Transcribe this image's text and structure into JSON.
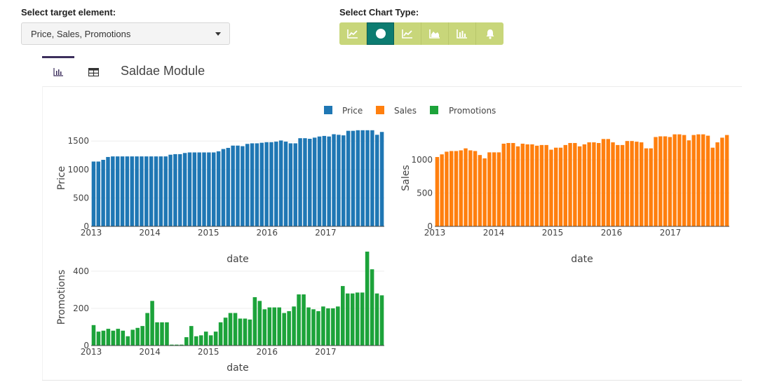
{
  "controls": {
    "target_label": "Select target element:",
    "target_value": "Price, Sales, Promotions",
    "charttype_label": "Select Chart Type:",
    "chart_types": [
      {
        "icon": "line-chart-icon",
        "active": false
      },
      {
        "icon": "circle-icon",
        "active": true
      },
      {
        "icon": "line-chart-icon",
        "active": false
      },
      {
        "icon": "area-chart-icon",
        "active": false
      },
      {
        "icon": "bar-chart-icon",
        "active": false
      },
      {
        "icon": "bell-icon",
        "active": false
      }
    ]
  },
  "tabs": {
    "chart_icon": "bar-chart-icon",
    "table_icon": "table-icon",
    "module_title": "Saldae Module"
  },
  "legend": [
    {
      "name": "Price",
      "color": "#1f77b4"
    },
    {
      "name": "Sales",
      "color": "#ff7f0e"
    },
    {
      "name": "Promotions",
      "color": "#1ca33a"
    }
  ],
  "chart_data": [
    {
      "type": "bar",
      "series_name": "Price",
      "color": "#1f77b4",
      "xlabel": "date",
      "ylabel": "Price",
      "x_ticks": [
        "2013",
        "2014",
        "2015",
        "2016",
        "2017"
      ],
      "y_ticks": [
        0,
        500,
        1000,
        1500
      ],
      "ylim": [
        0,
        1700
      ],
      "x_start": "2013-01",
      "values": [
        1140,
        1140,
        1170,
        1220,
        1230,
        1230,
        1230,
        1230,
        1230,
        1230,
        1230,
        1230,
        1230,
        1230,
        1230,
        1230,
        1260,
        1270,
        1270,
        1290,
        1300,
        1300,
        1300,
        1300,
        1300,
        1300,
        1320,
        1360,
        1380,
        1420,
        1420,
        1410,
        1450,
        1460,
        1460,
        1470,
        1480,
        1480,
        1490,
        1510,
        1490,
        1460,
        1460,
        1550,
        1550,
        1540,
        1560,
        1580,
        1590,
        1580,
        1620,
        1610,
        1600,
        1680,
        1680,
        1690,
        1690,
        1690,
        1690,
        1610,
        1660
      ]
    },
    {
      "type": "bar",
      "series_name": "Sales",
      "color": "#ff7f0e",
      "xlabel": "date",
      "ylabel": "Sales",
      "x_ticks": [
        "2013",
        "2014",
        "2015",
        "2016",
        "2017"
      ],
      "y_ticks": [
        0,
        500,
        1000
      ],
      "ylim": [
        0,
        1450
      ],
      "x_start": "2013-01",
      "values": [
        1040,
        1080,
        1120,
        1130,
        1130,
        1140,
        1170,
        1140,
        1130,
        1070,
        1020,
        1110,
        1110,
        1110,
        1240,
        1250,
        1250,
        1200,
        1240,
        1230,
        1230,
        1210,
        1220,
        1220,
        1150,
        1180,
        1180,
        1220,
        1250,
        1250,
        1200,
        1230,
        1260,
        1260,
        1250,
        1310,
        1310,
        1260,
        1220,
        1220,
        1280,
        1280,
        1270,
        1260,
        1170,
        1170,
        1340,
        1350,
        1350,
        1340,
        1380,
        1380,
        1370,
        1290,
        1370,
        1380,
        1380,
        1360,
        1180,
        1260,
        1330,
        1370
      ]
    },
    {
      "type": "bar",
      "series_name": "Promotions",
      "color": "#1ca33a",
      "xlabel": "date",
      "ylabel": "Promotions",
      "x_ticks": [
        "2013",
        "2014",
        "2015",
        "2016",
        "2017"
      ],
      "y_ticks": [
        0,
        200,
        400
      ],
      "ylim": [
        0,
        520
      ],
      "x_start": "2013-01",
      "values": [
        110,
        75,
        80,
        90,
        80,
        90,
        80,
        50,
        85,
        95,
        105,
        175,
        240,
        125,
        125,
        125,
        5,
        5,
        5,
        45,
        105,
        50,
        55,
        75,
        55,
        75,
        125,
        150,
        175,
        175,
        145,
        145,
        140,
        260,
        240,
        195,
        205,
        205,
        205,
        175,
        185,
        210,
        275,
        275,
        205,
        195,
        185,
        210,
        200,
        200,
        210,
        320,
        280,
        280,
        285,
        285,
        505,
        410,
        280,
        270
      ]
    }
  ]
}
